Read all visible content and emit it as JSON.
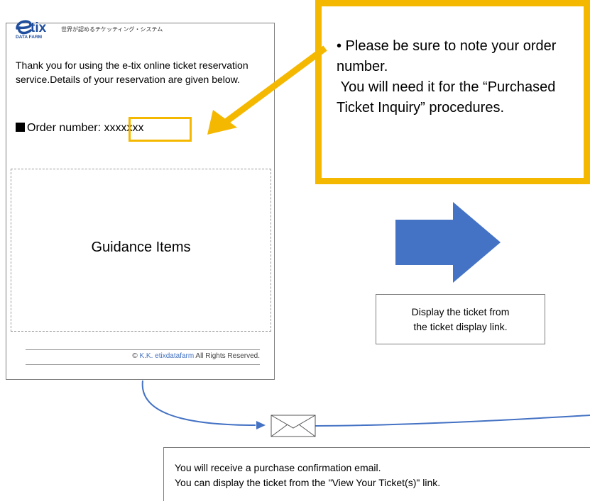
{
  "email_mock": {
    "logo_text": "tix",
    "logo_subtext": "DATA FARM",
    "tagline": "世界が認めるチケッティング・システム",
    "thanks": "Thank you for using the e-tix online ticket reservation service.Details of your reservation are given below.",
    "order_label": "Order number: ",
    "order_value": "xxxxxxx",
    "guidance": "Guidance Items",
    "copyright_prefix": "©",
    "copyright_link": "K.K. etixdatafarm",
    "copyright_suffix": "All Rights Reserved."
  },
  "callout": {
    "line1": "• Please be sure to note  your order number.",
    "line2": " You will need it for the “Purchased Ticket Inquiry” procedures."
  },
  "display_box": {
    "line1": "Display the ticket from",
    "line2": "the ticket display link."
  },
  "email_note": {
    "line1": "You will receive a purchase confirmation email.",
    "line2": "You can display the ticket from the \"View Your Ticket(s)\" link."
  },
  "colors": {
    "highlight": "#f5b800",
    "arrow_blue": "#4472c4",
    "link_blue": "#4472c4"
  },
  "icons": [
    "envelope-icon",
    "right-arrow-icon",
    "callout-arrow-icon"
  ]
}
